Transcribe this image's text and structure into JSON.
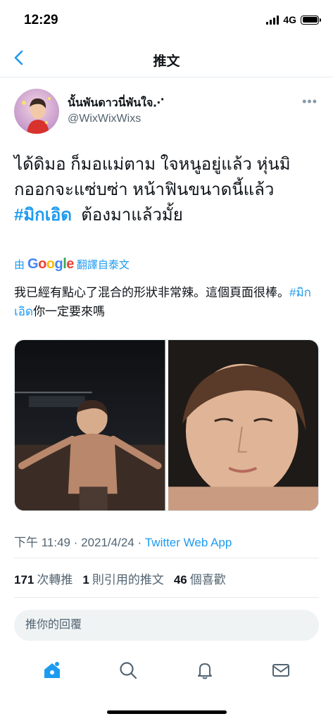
{
  "status_bar": {
    "time": "12:29",
    "network": "4G"
  },
  "nav": {
    "title": "推文"
  },
  "tweet": {
    "author_name": "นั้นพันดาวนี่พันใจ⋰",
    "author_handle": "@WixWixWixs",
    "text_line1": "ได้ดิมอ ก็มอแม่ตาม ใจหนูอยู่แล้ว หุ่นมิ",
    "text_line2": "กออกจะแซ่บซ่า หน้าฟินขนาดนี้แล้ว",
    "hashtag": "#มิกเอิด",
    "text_line3_rest": "ต้องมาแล้วมั้ย",
    "translate_prefix": "由",
    "translate_suffix": "翻譯自泰文",
    "translation_part1": "我已經有點心了混合的形狀非常辣。這個頁面很棒。",
    "translation_hashtag": "#มิกเอิด",
    "translation_part2": "你一定要來嗎",
    "time": "下午 11:49 · 2021/4/24 · ",
    "source": "Twitter Web App"
  },
  "stats": {
    "retweets": "171",
    "retweets_label": "次轉推",
    "quotes": "1",
    "quotes_label": "則引用的推文",
    "likes": "46",
    "likes_label": "個喜歡"
  },
  "reply": {
    "placeholder": "推你的回覆"
  },
  "icons": [
    "back-icon",
    "more-icon",
    "home-icon",
    "search-icon",
    "notifications-icon",
    "messages-icon"
  ],
  "colors": {
    "accent": "#1d9bf0",
    "text": "#0f1419",
    "secondary": "#536471"
  }
}
